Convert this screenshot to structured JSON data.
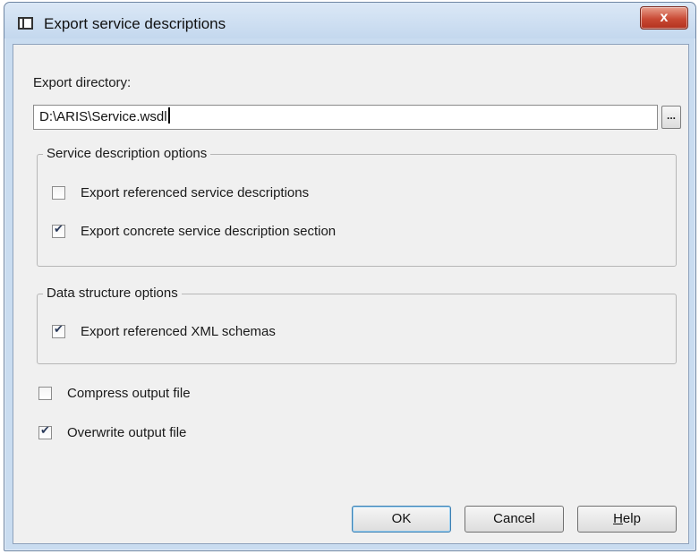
{
  "window": {
    "title": "Export service descriptions",
    "close_label": "x"
  },
  "export_directory": {
    "label": "Export directory:",
    "value": "D:\\ARIS\\Service.wsdl",
    "browse_label": "..."
  },
  "service_description_options": {
    "legend": "Service description options",
    "options": [
      {
        "label": "Export referenced service descriptions",
        "checked": false
      },
      {
        "label": "Export concrete service description section",
        "checked": true
      }
    ]
  },
  "data_structure_options": {
    "legend": "Data structure options",
    "options": [
      {
        "label": "Export referenced XML schemas",
        "checked": true
      }
    ]
  },
  "general_options": [
    {
      "label": "Compress output file",
      "checked": false
    },
    {
      "label": "Overwrite output file",
      "checked": true
    }
  ],
  "buttons": {
    "ok": "OK",
    "cancel": "Cancel",
    "help_first": "H",
    "help_rest": "elp"
  }
}
